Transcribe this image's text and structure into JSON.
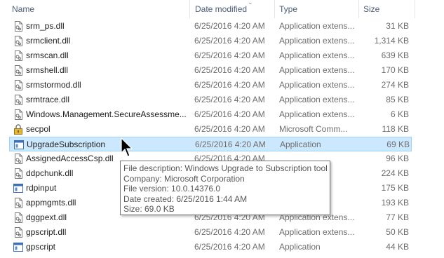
{
  "columns": {
    "name": "Name",
    "date": "Date modified",
    "type": "Type",
    "size": "Size"
  },
  "files": [
    {
      "name": "srm_ps.dll",
      "date": "6/25/2016 4:20 AM",
      "type": "Application extens...",
      "size": "31 KB",
      "icon": "dll-file-icon"
    },
    {
      "name": "srmclient.dll",
      "date": "6/25/2016 4:20 AM",
      "type": "Application extens...",
      "size": "1,314 KB",
      "icon": "dll-file-icon"
    },
    {
      "name": "srmscan.dll",
      "date": "6/25/2016 4:20 AM",
      "type": "Application extens...",
      "size": "639 KB",
      "icon": "dll-file-icon"
    },
    {
      "name": "srmshell.dll",
      "date": "6/25/2016 4:20 AM",
      "type": "Application extens...",
      "size": "170 KB",
      "icon": "dll-file-icon"
    },
    {
      "name": "srmstormod.dll",
      "date": "6/25/2016 4:20 AM",
      "type": "Application extens...",
      "size": "274 KB",
      "icon": "dll-file-icon"
    },
    {
      "name": "srmtrace.dll",
      "date": "6/25/2016 4:20 AM",
      "type": "Application extens...",
      "size": "85 KB",
      "icon": "dll-file-icon"
    },
    {
      "name": "Windows.Management.SecureAssessme...",
      "date": "6/25/2016 4:20 AM",
      "type": "Application extens...",
      "size": "6 KB",
      "icon": "dll-file-icon"
    },
    {
      "name": "secpol",
      "date": "6/25/2016 4:20 AM",
      "type": "Microsoft Comm...",
      "size": "118 KB",
      "icon": "security-policy-icon"
    },
    {
      "name": "UpgradeSubscription",
      "date": "6/25/2016 4:20 AM",
      "type": "Application",
      "size": "69 KB",
      "icon": "application-icon",
      "selected": true
    },
    {
      "name": "AssignedAccessCsp.dll",
      "date": "6/25/2016 4:20 AM",
      "type": "",
      "size": "96 KB",
      "icon": "dll-file-icon"
    },
    {
      "name": "ddpchunk.dll",
      "date": "",
      "type": "",
      "size": "224 KB",
      "icon": "dll-file-icon"
    },
    {
      "name": "rdpinput",
      "date": "",
      "type": "",
      "size": "175 KB",
      "icon": "application-icon"
    },
    {
      "name": "appmgmts.dll",
      "date": "",
      "type": "",
      "size": "193 KB",
      "icon": "dll-file-icon"
    },
    {
      "name": "dggpext.dll",
      "date": "6/25/2016 4:20 AM",
      "type": "Application extens...",
      "size": "77 KB",
      "icon": "dll-file-icon"
    },
    {
      "name": "gpscript.dll",
      "date": "6/25/2016 4:20 AM",
      "type": "Application extens...",
      "size": "50 KB",
      "icon": "dll-file-icon"
    },
    {
      "name": "gpscript",
      "date": "6/25/2016 4:20 AM",
      "type": "Application",
      "size": "44 KB",
      "icon": "application-icon"
    }
  ],
  "tooltip": {
    "description": "File description: Windows Upgrade to Subscription tool",
    "company": "Company: Microsoft Corporation",
    "version": "File version: 10.0.14376.0",
    "created": "Date created: 6/25/2016 1:44 AM",
    "size": "Size: 69.0 KB"
  },
  "colors": {
    "selection_bg": "#cce8ff",
    "selection_border": "#99d1ff",
    "header_text": "#4c607a"
  }
}
